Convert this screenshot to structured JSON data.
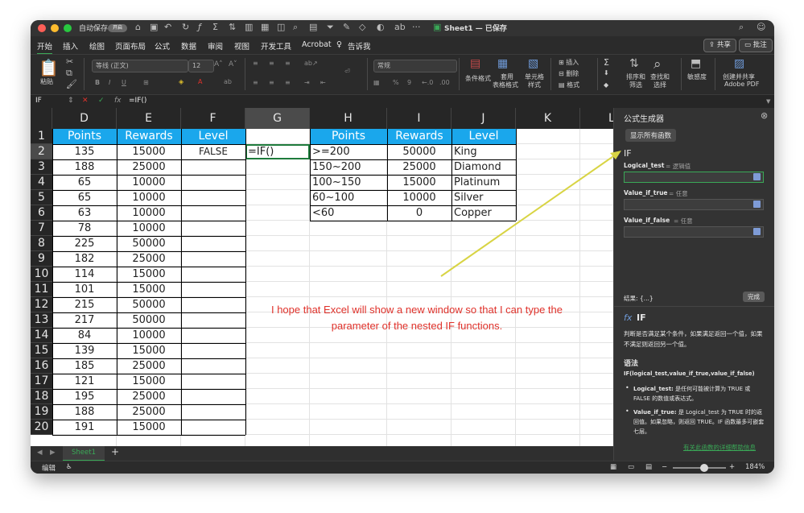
{
  "titlebar": {
    "autosave_label": "自动保存",
    "autosave_state": "开启",
    "doc_title": "Sheet1 — 已保存"
  },
  "menubar": {
    "tabs": [
      "开始",
      "插入",
      "绘图",
      "页面布局",
      "公式",
      "数据",
      "审阅",
      "视图",
      "开发工具",
      "Acrobat",
      "告诉我"
    ],
    "share_label": "共享",
    "comments_label": "批注"
  },
  "ribbon": {
    "paste_label": "粘贴",
    "font_name": "等线 (正文)",
    "font_size": "12",
    "number_format": "常规",
    "conditional_label": "条件格式",
    "table_label_1": "套用",
    "table_label_2": "表格格式",
    "cell_style_label_1": "单元格",
    "cell_style_label_2": "样式",
    "insert_label": "插入",
    "delete_label": "删除",
    "format_label": "格式",
    "sort_label_1": "排序和",
    "sort_label_2": "筛选",
    "find_label_1": "查找和",
    "find_label_2": "选择",
    "sensitivity_label": "敏感度",
    "adobe_label_1": "创建并共享",
    "adobe_label_2": "Adobe PDF"
  },
  "formula_bar": {
    "name_box": "IF",
    "fx": "fx",
    "formula": "=IF()"
  },
  "sheet": {
    "columns": [
      "D",
      "E",
      "F",
      "G",
      "H",
      "I",
      "J",
      "K",
      "L"
    ],
    "rows": [
      "1",
      "2",
      "3",
      "4",
      "5",
      "6",
      "7",
      "8",
      "9",
      "10",
      "11",
      "12",
      "13",
      "14",
      "15",
      "16",
      "17",
      "18",
      "19",
      "20"
    ],
    "headers": {
      "d": "Points",
      "e": "Rewards",
      "f": "Level",
      "h": "Points",
      "i": "Rewards",
      "j": "Level"
    },
    "data_d": [
      "135",
      "188",
      "65",
      "65",
      "63",
      "78",
      "225",
      "182",
      "114",
      "101",
      "215",
      "217",
      "84",
      "139",
      "185",
      "121",
      "195",
      "188",
      "191"
    ],
    "data_e": [
      "15000",
      "25000",
      "10000",
      "10000",
      "10000",
      "10000",
      "50000",
      "25000",
      "15000",
      "15000",
      "50000",
      "50000",
      "10000",
      "15000",
      "25000",
      "15000",
      "25000",
      "25000",
      "15000"
    ],
    "f2": "FALSE",
    "g2": "=IF()",
    "lookup_h": [
      ">=200",
      "150~200",
      "100~150",
      "60~100",
      "<60"
    ],
    "lookup_i": [
      "50000",
      "25000",
      "15000",
      "10000",
      "0"
    ],
    "lookup_j": [
      "King",
      "Diamond",
      "Platinum",
      "Silver",
      "Copper"
    ],
    "annotation": "I hope that Excel will show a new window so that I can type the parameter of the nested IF functions."
  },
  "sheet_tabs": {
    "active": "Sheet1",
    "add": "+"
  },
  "statusbar": {
    "mode": "编辑",
    "zoom": "184%"
  },
  "formula_builder": {
    "title": "公式生成器",
    "show_all": "显示所有函数",
    "function_name": "IF",
    "arg1_label": "Logical_test",
    "arg1_hint": "= 逻辑值",
    "arg2_label": "Value_if_true",
    "arg2_hint": "= 任意",
    "arg3_label": "Value_if_false",
    "arg3_hint": "= 任意",
    "result_label": "结果: {...}",
    "done_label": "完成",
    "fx_title": "IF",
    "description": "判断是否满足某个条件，如果满足返回一个值，如果不满足则返回另一个值。",
    "syntax_heading": "语法",
    "syntax": "IF(logical_test,value_if_true,value_if_false)",
    "bullet1_name": "Logical_test:",
    "bullet1_text": "是任何可能被计算为 TRUE 或 FALSE 的数值或表达式。",
    "bullet2_name": "Value_if_true:",
    "bullet2_text": "是 Logical_test 为 TRUE 时的返回值。如果忽略，则返回 TRUE。IF 函数最多可嵌套七层。",
    "help_link": "有关此函数的详细帮助信息"
  },
  "colors": {
    "header_blue": "#1aa7ec",
    "accent_green": "#3aa957",
    "annotation_red": "#e0322b",
    "arrow_yellow": "#d8d444"
  }
}
